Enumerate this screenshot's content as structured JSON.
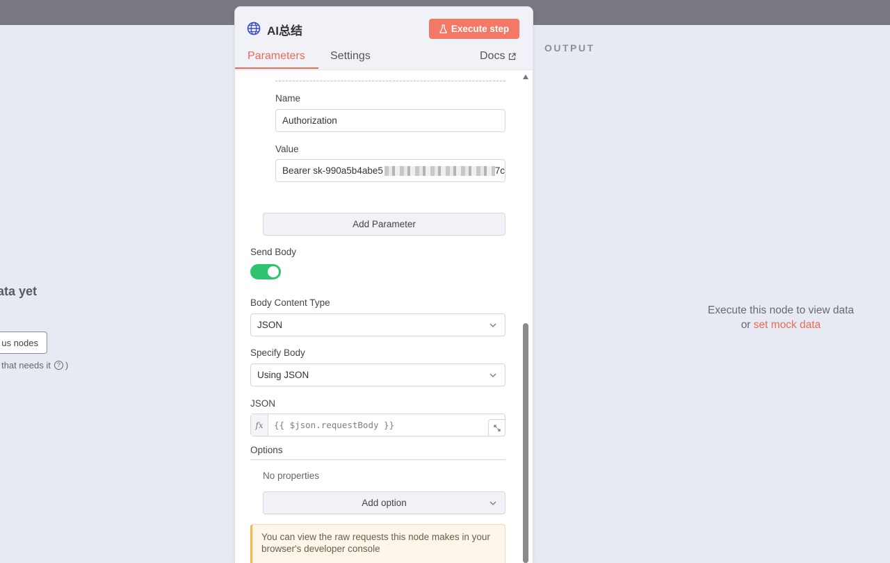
{
  "background": {
    "left_title": "ata yet",
    "left_button": "us nodes",
    "left_hint": "that needs it",
    "left_hint_suffix": ")",
    "output_label": "OUTPUT",
    "output_message_line1": "Execute this node to view data",
    "output_message_or": "or",
    "output_message_link": "set mock data"
  },
  "panel": {
    "node_title": "AI总结",
    "execute_button": "Execute step",
    "tabs": {
      "parameters": "Parameters",
      "settings": "Settings",
      "docs": "Docs"
    },
    "header_param": {
      "name_label": "Name",
      "name_value": "Authorization",
      "value_label": "Value",
      "value_prefix": "Bearer sk-990a5b4abe5",
      "value_suffix": "7c"
    },
    "add_parameter_button": "Add Parameter",
    "send_body_label": "Send Body",
    "send_body_enabled": true,
    "body_content_type_label": "Body Content Type",
    "body_content_type_value": "JSON",
    "specify_body_label": "Specify Body",
    "specify_body_value": "Using JSON",
    "json_label": "JSON",
    "json_fx": "fx",
    "json_expression": "{{ $json.requestBody }}",
    "options_label": "Options",
    "no_properties": "No properties",
    "add_option_button": "Add option",
    "notice": "You can view the raw requests this node makes in your browser's developer console"
  },
  "colors": {
    "accent": "#ee6a52",
    "execute_button": "#f37866",
    "toggle_on": "#2fc271",
    "topbar": "#787882",
    "canvas_bg": "#e7eaf2"
  },
  "icons": {
    "node_icon": "globe-icon",
    "execute_icon": "flask-icon",
    "docs_icon": "external-link-icon",
    "select_icon": "chevron-down-icon",
    "expand_icon": "expand-icon",
    "help_icon": "question-circle-icon"
  }
}
